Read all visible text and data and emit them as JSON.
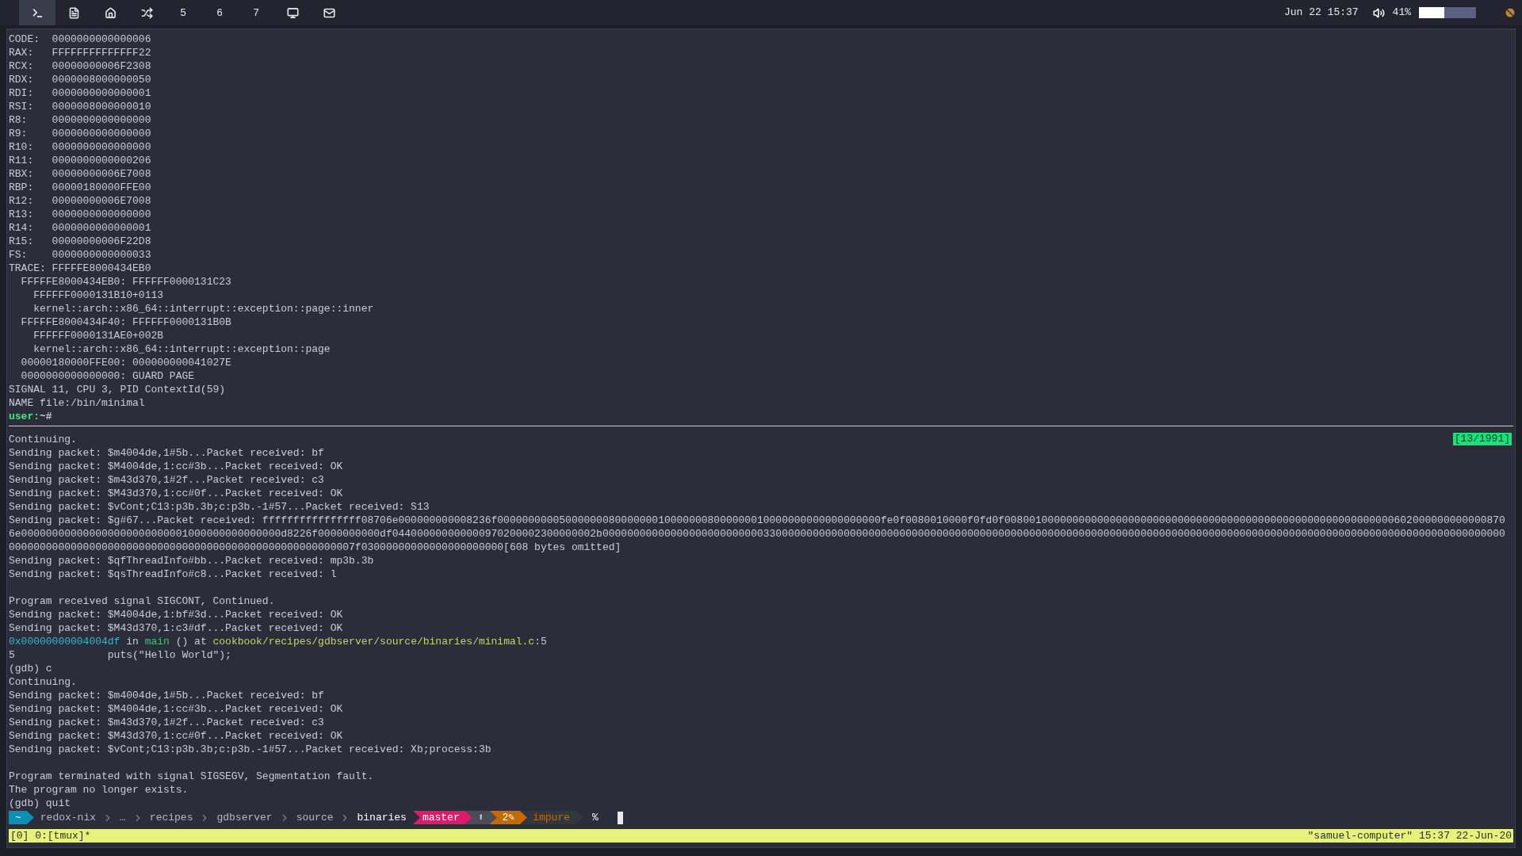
{
  "top_bar": {
    "workspaces": [
      {
        "kind": "terminal",
        "selected": true
      },
      {
        "kind": "file",
        "selected": false
      },
      {
        "kind": "home",
        "selected": false
      },
      {
        "kind": "shuffle",
        "selected": false
      },
      {
        "kind": "number",
        "label": "5",
        "selected": false
      },
      {
        "kind": "number",
        "label": "6",
        "selected": false
      },
      {
        "kind": "number",
        "label": "7",
        "selected": false
      },
      {
        "kind": "monitor",
        "selected": false
      },
      {
        "kind": "mail",
        "selected": false
      }
    ],
    "clock": "Jun 22 15:37",
    "volume": {
      "reading": "41%",
      "level": 0.45
    }
  },
  "upper_pane": {
    "lines": [
      {
        "text": "CODE:  0000000000000006"
      },
      {
        "text": "RAX:   FFFFFFFFFFFFFF22"
      },
      {
        "text": "RCX:   00000000006F2308"
      },
      {
        "text": "RDX:   0000008000000050"
      },
      {
        "text": "RDI:   0000000000000001"
      },
      {
        "text": "RSI:   0000008000000010"
      },
      {
        "text": "R8:    0000000000000000"
      },
      {
        "text": "R9:    0000000000000000"
      },
      {
        "text": "R10:   0000000000000000"
      },
      {
        "text": "R11:   0000000000000206"
      },
      {
        "text": "RBX:   00000000006E7008"
      },
      {
        "text": "RBP:   00000180000FFE00"
      },
      {
        "text": "R12:   00000000006E7008"
      },
      {
        "text": "R13:   0000000000000000"
      },
      {
        "text": "R14:   0000000000000001"
      },
      {
        "text": "R15:   00000000006F22D8"
      },
      {
        "text": "FS:    0000000000000033"
      },
      {
        "text": "TRACE: FFFFFE8000434EB0"
      },
      {
        "text": "  FFFFFE8000434EB0: FFFFFF0000131C23"
      },
      {
        "text": "    FFFFFF0000131B10+0113"
      },
      {
        "text": "    kernel::arch::x86_64::interrupt::exception::page::inner"
      },
      {
        "text": "  FFFFFE8000434F40: FFFFFF0000131B0B"
      },
      {
        "text": "    FFFFFF0000131AE0+002B"
      },
      {
        "text": "    kernel::arch::x86_64::interrupt::exception::page"
      },
      {
        "text": "  00000180000FFE00: 000000000041027E"
      },
      {
        "text": "  0000000000000000: GUARD PAGE"
      },
      {
        "text": "SIGNAL 11, CPU 3, PID ContextId(59)"
      },
      {
        "text": "NAME file:/bin/minimal"
      },
      {
        "segments": [
          {
            "text": "user:",
            "color": "#3ee87e",
            "bold": true
          },
          {
            "text": "~#",
            "color": "#c8ccd8",
            "bold": true
          }
        ]
      }
    ]
  },
  "lower_pane": {
    "position": "[13/1991]",
    "lines": [
      {
        "text": "Continuing."
      },
      {
        "text": "Sending packet: $m4004de,1#5b...Packet received: bf"
      },
      {
        "text": "Sending packet: $M4004de,1:cc#3b...Packet received: OK"
      },
      {
        "text": "Sending packet: $m43d370,1#2f...Packet received: c3"
      },
      {
        "text": "Sending packet: $M43d370,1:cc#0f...Packet received: OK"
      },
      {
        "text": "Sending packet: $vCont;C13:p3b.3b;c:p3b.-1#57...Packet received: S13"
      },
      {
        "text": "Sending packet: $g#67...Packet received: ffffffffffffffff08706e000000000008236f00000000005000000080000000100000008000000010000000000000000000fe0f0080010000f0fd0f008001000000000000000000000000000000000000000000000000000000000602000000000000870"
      },
      {
        "text": "6e000000000000000000000000001000000000000000d8226f0000000000df044000000000000970200002300000002b00000000000000000000000000330000000000000000000000000000000000000000000000000000000000000000000000000000000000000000000000000000000000000000000000"
      },
      {
        "text": "00000000000000000000000000000000000000000000000000000007f03000000000000000000000[608 bytes omitted]"
      },
      {
        "text": "Sending packet: $qfThreadInfo#bb...Packet received: mp3b.3b"
      },
      {
        "text": "Sending packet: $qsThreadInfo#c8...Packet received: l"
      },
      {
        "kind": "blank"
      },
      {
        "text": "Program received signal SIGCONT, Continued."
      },
      {
        "text": "Sending packet: $M4004de,1:bf#3d...Packet received: OK"
      },
      {
        "text": "Sending packet: $M43d370,1:c3#df...Packet received: OK"
      },
      {
        "segments": [
          {
            "text": "0x00000000004004df",
            "color": "#37b6c8",
            "bold": false
          },
          {
            "text": " in ",
            "color": "#c8ccd8",
            "bold": false
          },
          {
            "text": "main",
            "color": "#3ec46d",
            "bold": false
          },
          {
            "text": " () at ",
            "color": "#c8ccd8",
            "bold": false
          },
          {
            "text": "cookbook/recipes/gdbserver/source/binaries/minimal.c",
            "color": "#c9d16a",
            "bold": false
          },
          {
            "text": ":5",
            "color": "#c8ccd8",
            "bold": false
          }
        ]
      },
      {
        "text": "5               puts(\"Hello World\");"
      },
      {
        "text": "(gdb) c"
      },
      {
        "text": "Continuing."
      },
      {
        "text": "Sending packet: $m4004de,1#5b...Packet received: bf"
      },
      {
        "text": "Sending packet: $M4004de,1:cc#3b...Packet received: OK"
      },
      {
        "text": "Sending packet: $m43d370,1#2f...Packet received: c3"
      },
      {
        "text": "Sending packet: $M43d370,1:cc#0f...Packet received: OK"
      },
      {
        "text": "Sending packet: $vCont;C13:p3b.3b;c:p3b.-1#57...Packet received: Xb;process:3b"
      },
      {
        "kind": "blank"
      },
      {
        "text": "Program terminated with signal SIGSEGV, Segmentation fault."
      },
      {
        "text": "The program no longer exists."
      },
      {
        "text": "(gdb) quit"
      }
    ]
  },
  "prompt": {
    "segments": [
      {
        "kind": "home",
        "text": "~"
      },
      {
        "kind": "dir",
        "text": "redox-nix"
      },
      {
        "kind": "dir",
        "text": "…"
      },
      {
        "kind": "dir",
        "text": "recipes"
      },
      {
        "kind": "dir",
        "text": "gdbserver"
      },
      {
        "kind": "dir",
        "text": "source"
      },
      {
        "kind": "current",
        "text": "binaries"
      },
      {
        "kind": "branch",
        "text": "master"
      },
      {
        "kind": "ahead",
        "text": "⬆"
      },
      {
        "kind": "changes",
        "text": "2✎"
      },
      {
        "kind": "env",
        "text": "impure"
      },
      {
        "kind": "symbol",
        "text": "%"
      }
    ]
  },
  "tmux_status": {
    "left": "[0] 0:[tmux]*",
    "right": "\"samuel-computer\" 15:37 22-Jun-20"
  }
}
